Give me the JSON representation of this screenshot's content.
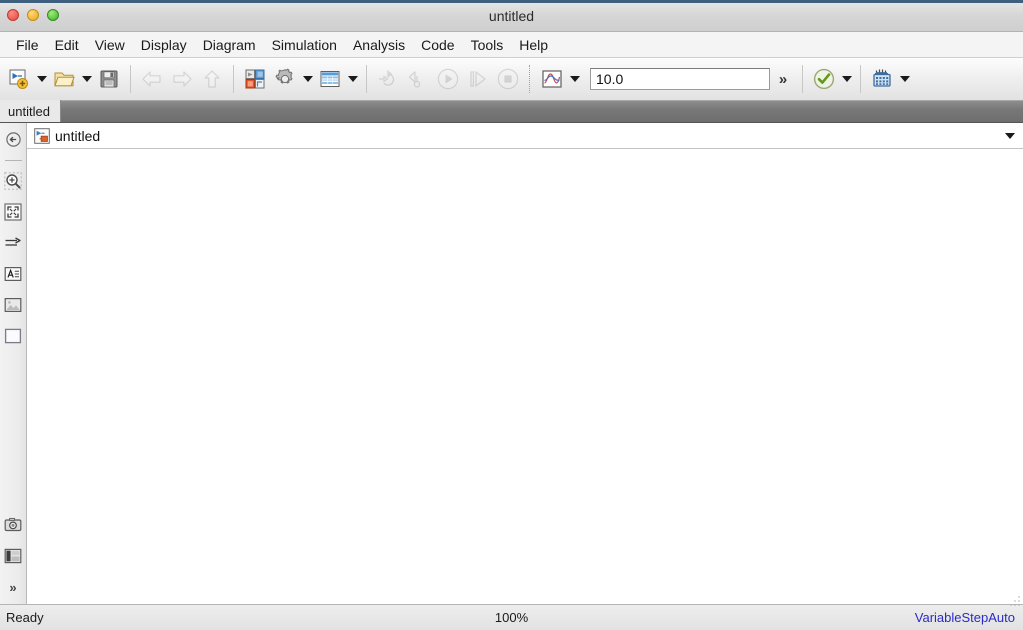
{
  "window": {
    "title": "untitled",
    "controls": [
      {
        "name": "close",
        "color": "#e0483e"
      },
      {
        "name": "minimize",
        "color": "#e8a516"
      },
      {
        "name": "maximize",
        "color": "#35b225"
      }
    ]
  },
  "menubar": {
    "items": [
      {
        "label": "File"
      },
      {
        "label": "Edit"
      },
      {
        "label": "View"
      },
      {
        "label": "Display"
      },
      {
        "label": "Diagram"
      },
      {
        "label": "Simulation"
      },
      {
        "label": "Analysis"
      },
      {
        "label": "Code"
      },
      {
        "label": "Tools"
      },
      {
        "label": "Help"
      }
    ]
  },
  "toolbar": {
    "new_model": {
      "icon": "new-model-icon",
      "enabled": true
    },
    "new_model_caret": "dropdown-caret",
    "open": {
      "icon": "open-folder-icon",
      "enabled": true
    },
    "open_caret": "dropdown-caret",
    "save": {
      "icon": "save-floppy-icon",
      "enabled": true
    },
    "undo": {
      "icon": "undo-arrow-icon",
      "enabled": false
    },
    "redo": {
      "icon": "redo-arrow-icon",
      "enabled": false
    },
    "up_to_parent": {
      "icon": "up-arrow-icon",
      "enabled": false
    },
    "library_browser": {
      "icon": "library-browser-icon",
      "enabled": true
    },
    "model_configuration": {
      "icon": "gear-icon",
      "enabled": true
    },
    "model_configuration_caret": "dropdown-caret",
    "model_explorer": {
      "icon": "model-explorer-icon",
      "enabled": true
    },
    "model_explorer_caret": "dropdown-caret",
    "update_model": {
      "icon": "update-model-icon",
      "enabled": false
    },
    "build_model": {
      "icon": "build-model-icon",
      "enabled": false
    },
    "run": {
      "icon": "play-run-icon",
      "enabled": false
    },
    "step_forward": {
      "icon": "step-forward-icon",
      "enabled": false
    },
    "stop": {
      "icon": "stop-square-icon",
      "enabled": false
    },
    "simulation_mode": {
      "icon": "simulation-plot-icon",
      "enabled": true
    },
    "simulation_mode_caret": "dropdown-caret",
    "stop_time": {
      "value": "10.0",
      "placeholder": "10.0"
    },
    "overflow": {
      "icon": "double-chevron-icon",
      "label": "»"
    },
    "model_advisor": {
      "icon": "check-circle-icon",
      "enabled": true
    },
    "model_advisor_caret": "dropdown-caret",
    "model_builder": {
      "icon": "build-grid-icon",
      "enabled": true
    },
    "model_builder_caret": "dropdown-caret"
  },
  "tabstrip": {
    "tabs": [
      {
        "label": "untitled",
        "active": true
      }
    ]
  },
  "sidebar": {
    "items": [
      {
        "name": "navigate-back-icon",
        "label": "Back"
      },
      {
        "name": "zoom-in-icon",
        "label": "Zoom In"
      },
      {
        "name": "fit-to-view-icon",
        "label": "Fit To View"
      },
      {
        "name": "signal-arrow-icon",
        "label": "Signal"
      },
      {
        "name": "text-annotation-icon",
        "label": "Text Annotation"
      },
      {
        "name": "image-annotation-icon",
        "label": "Image Annotation"
      },
      {
        "name": "area-rectangle-icon",
        "label": "Area"
      }
    ],
    "bottom_items": [
      {
        "name": "camera-snapshot-icon",
        "label": "Snapshot"
      },
      {
        "name": "layers-panel-icon",
        "label": "Panels"
      }
    ],
    "overflow": {
      "name": "double-chevron-icon",
      "label": "»"
    }
  },
  "breadcrumb": {
    "icon": "simulink-model-icon",
    "label": "untitled",
    "caret": "dropdown-caret"
  },
  "statusbar": {
    "left": "Ready",
    "center": "100%",
    "right": "VariableStepAuto",
    "right_color": "#2a2ac8",
    "grip": "resize-grip-icon"
  }
}
